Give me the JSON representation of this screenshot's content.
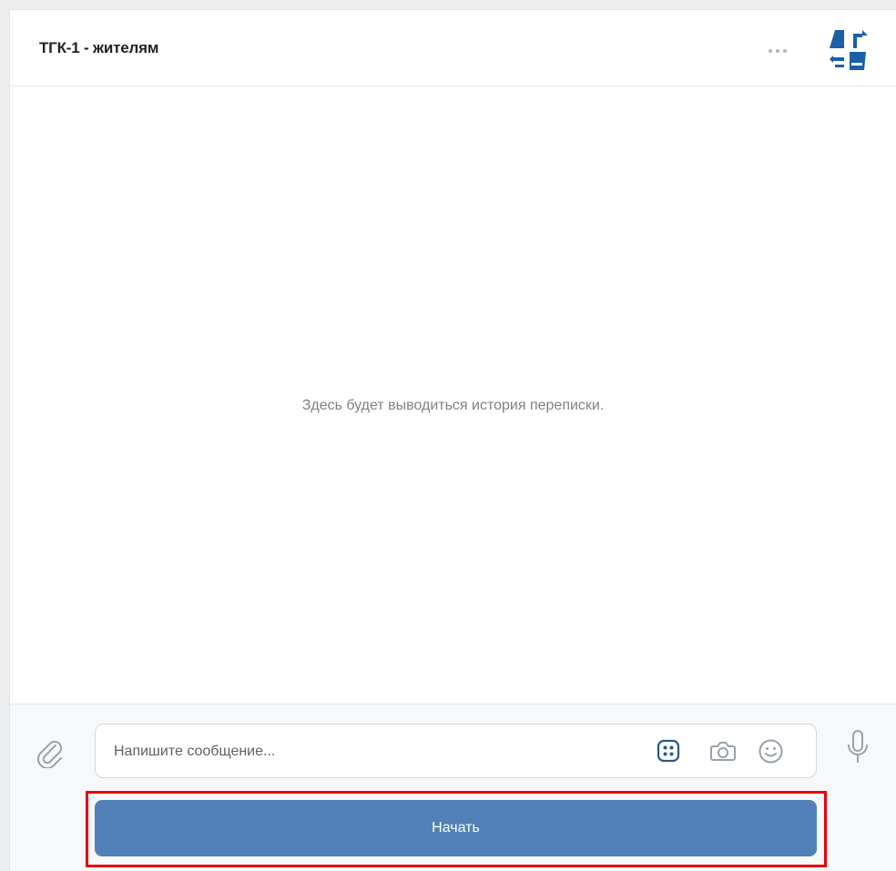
{
  "header": {
    "title": "ТГК-1 - жителям",
    "more_icon": "more-horizontal-icon",
    "logo_icon": "community-logo"
  },
  "conversation": {
    "empty_text": "Здесь будет выводиться история переписки."
  },
  "composer": {
    "placeholder": "Напишите сообщение...",
    "attach_icon": "paperclip-icon",
    "keyboard_icon": "bot-keyboard-icon",
    "camera_icon": "camera-icon",
    "emoji_icon": "smile-icon",
    "mic_icon": "microphone-icon",
    "start_label": "Начать"
  },
  "colors": {
    "accent": "#5181b8",
    "highlight": "#e8000b",
    "logo_blue": "#1a5fa8"
  }
}
